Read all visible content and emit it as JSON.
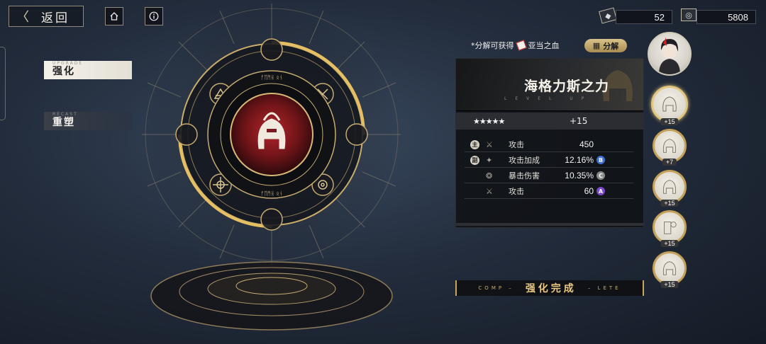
{
  "topbar": {
    "back_label": "返回",
    "home_icon": "home-icon",
    "info_icon": "info-icon",
    "currency1": {
      "icon": "card-icon",
      "value": "52"
    },
    "currency2": {
      "icon": "coin-icon",
      "value": "5808"
    }
  },
  "tabs": [
    {
      "sub": "UPGRADE",
      "label": "强化",
      "active": true
    },
    {
      "sub": "RECAST",
      "label": "重塑",
      "active": false
    }
  ],
  "decompose": {
    "prefix": "*分解可获得",
    "reward": "亚当之血",
    "button_label": "分解"
  },
  "item": {
    "name": "海格力斯之力",
    "level_up": "LEVEL UP",
    "stars": "★★★★★",
    "enhance": "+15",
    "stats": [
      {
        "badge": "主",
        "icon": "sword-icon",
        "label": "攻击",
        "value": "450",
        "grade": ""
      },
      {
        "badge": "副",
        "icon": "crit-icon",
        "label": "攻击加成",
        "value": "12.16%",
        "grade": "B",
        "grade_color": "#3d6fd6"
      },
      {
        "badge": "",
        "icon": "burst-icon",
        "label": "暴击伤害",
        "value": "10.35%",
        "grade": "C",
        "grade_color": "#8a8a8a"
      },
      {
        "badge": "",
        "icon": "sword-icon",
        "label": "攻击",
        "value": "60",
        "grade": "A",
        "grade_color": "#7b47c9"
      }
    ]
  },
  "complete": {
    "left": "COMP –",
    "label": "强化完成",
    "right": "– LETE"
  },
  "slots": [
    {
      "plus": "+15",
      "selected": true
    },
    {
      "plus": "+7",
      "selected": false
    },
    {
      "plus": "+15",
      "selected": false
    },
    {
      "plus": "+15",
      "selected": false
    },
    {
      "plus": "+15",
      "selected": false
    }
  ],
  "colors": {
    "accent_gold": "#c7a65e",
    "emblem_red": "#8b1d22"
  }
}
